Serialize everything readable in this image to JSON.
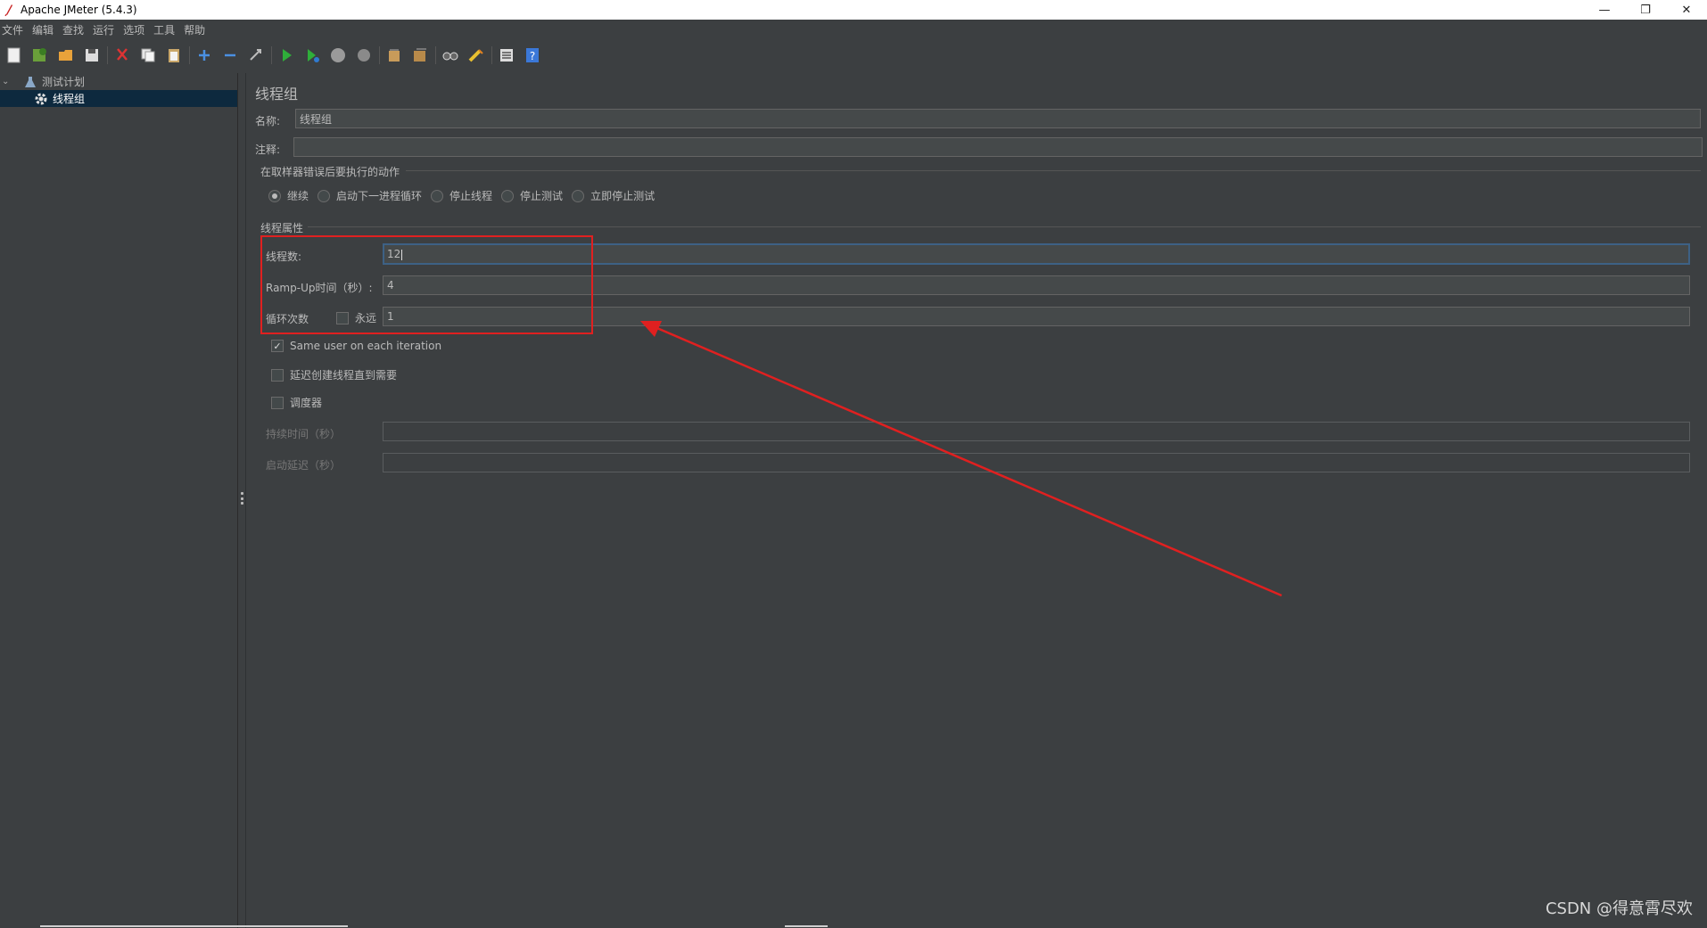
{
  "window": {
    "title": "Apache JMeter (5.4.3)",
    "minimize": "—",
    "restore": "❐",
    "close": "✕"
  },
  "menu": [
    "文件",
    "编辑",
    "查找",
    "运行",
    "选项",
    "工具",
    "帮助"
  ],
  "toolbar": {
    "icons": [
      "new-icon",
      "templates-icon",
      "open-icon",
      "save-icon",
      "cut-icon",
      "copy-icon",
      "paste-icon",
      "expand-icon",
      "collapse-icon",
      "toggle-icon",
      "start-icon",
      "start-no-pause-icon",
      "stop-icon",
      "shutdown-icon",
      "clear-icon",
      "clear-all-icon",
      "search-icon",
      "reset-search-icon",
      "function-helper-icon",
      "help-icon"
    ]
  },
  "tree": {
    "root_label": "测试计划",
    "child_label": "线程组"
  },
  "panel": {
    "title": "线程组",
    "name_label": "名称:",
    "name_value": "线程组",
    "comment_label": "注释:",
    "comment_value": "",
    "error_group_title": "在取样器错误后要执行的动作",
    "error_options": [
      {
        "label": "继续",
        "selected": true
      },
      {
        "label": "启动下一进程循环",
        "selected": false
      },
      {
        "label": "停止线程",
        "selected": false
      },
      {
        "label": "停止测试",
        "selected": false
      },
      {
        "label": "立即停止测试",
        "selected": false
      }
    ],
    "thread_props_title": "线程属性",
    "threads_label": "线程数:",
    "threads_value": "12",
    "rampup_label": "Ramp-Up时间（秒）:",
    "rampup_value": "4",
    "loop_label": "循环次数",
    "forever_label": "永远",
    "forever_checked": false,
    "loop_value": "1",
    "same_user_label": "Same user on each iteration",
    "same_user_checked": true,
    "delay_label": "延迟创建线程直到需要",
    "delay_checked": false,
    "scheduler_label": "调度器",
    "scheduler_checked": false,
    "duration_label": "持续时间（秒）",
    "duration_value": "",
    "startup_delay_label": "启动延迟（秒）",
    "startup_delay_value": ""
  },
  "annotation": {
    "box_color": "#e02020",
    "arrow_color": "#e02020"
  },
  "watermark": "CSDN @得意霄尽欢"
}
